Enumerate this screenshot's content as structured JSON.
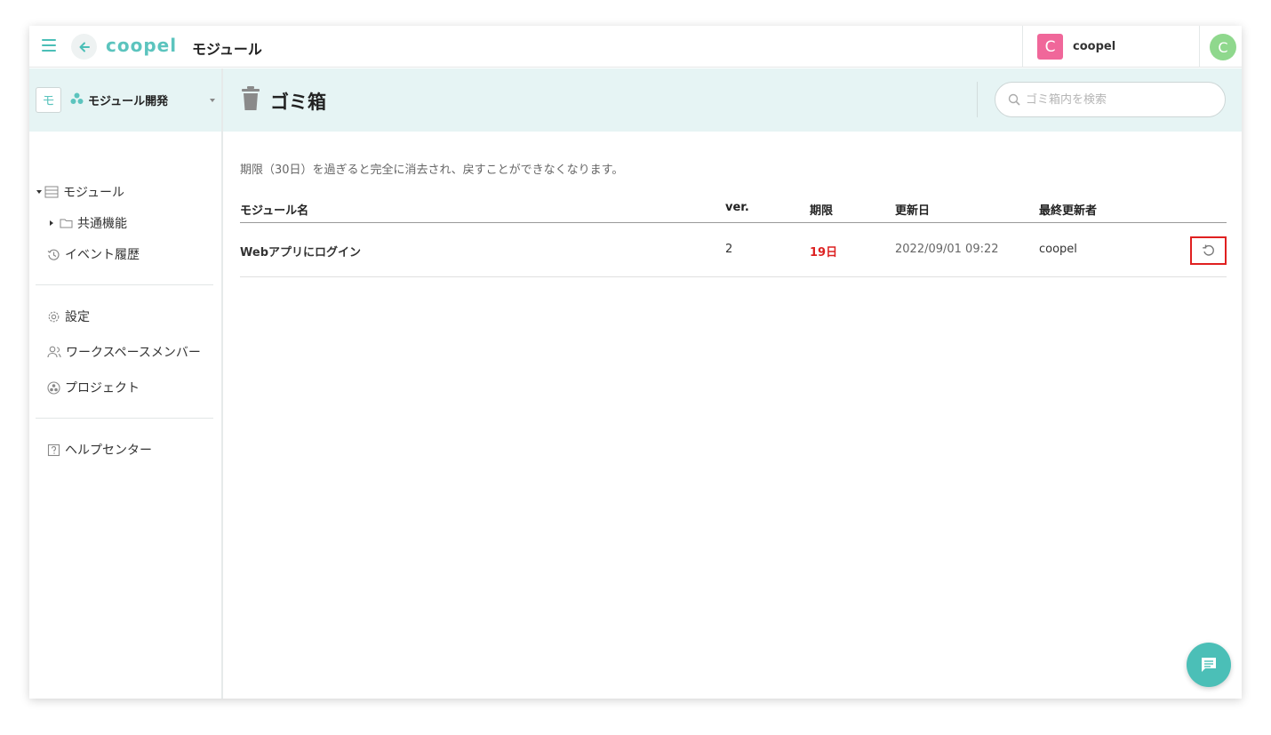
{
  "header": {
    "logo": "coopel",
    "title": "モジュール",
    "user": {
      "avatar_letter": "C",
      "name": "coopel"
    },
    "account_avatar_letter": "C"
  },
  "sidebar": {
    "workspace": {
      "badge": "モ",
      "name": "モジュール開発"
    },
    "tree": {
      "modules": "モジュール",
      "common": "共通機能",
      "history": "イベント履歴"
    },
    "menu": {
      "settings": "設定",
      "members": "ワークスペースメンバー",
      "projects": "プロジェクト",
      "help": "ヘルプセンター"
    }
  },
  "main": {
    "title": "ゴミ箱",
    "search_placeholder": "ゴミ箱内を検索",
    "notice": "期限（30日）を過ぎると完全に消去され、戻すことができなくなります。",
    "columns": {
      "name": "モジュール名",
      "ver": "ver.",
      "expire": "期限",
      "updated": "更新日",
      "updater": "最終更新者"
    },
    "rows": [
      {
        "name": "Webアプリにログイン",
        "ver": "2",
        "expire": "19日",
        "updated": "2022/09/01 09:22",
        "updater": "coopel"
      }
    ]
  },
  "colors": {
    "accent": "#4bbfb7",
    "header_bg": "#e6f4f4",
    "expire_red": "#dd2222",
    "user_avatar": "#f0679a",
    "account_avatar": "#8fd88d"
  }
}
